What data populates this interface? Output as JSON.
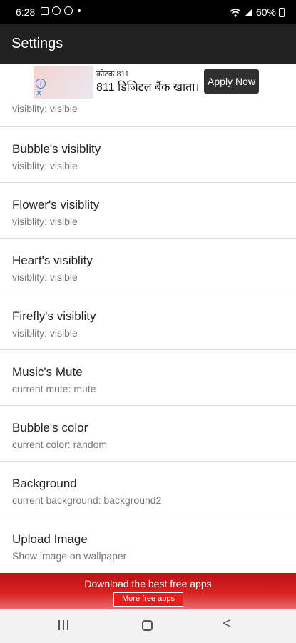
{
  "status_bar": {
    "time": "6:28",
    "battery": "60%"
  },
  "app_bar": {
    "title": "Settings"
  },
  "ad_top": {
    "line1": "कोटक 811",
    "line2": "811 डिजिटल बैंक खाता।",
    "cta": "Apply Now"
  },
  "settings": {
    "partial_summary": "visiblity: visible",
    "items": [
      {
        "title": "Bubble's visiblity",
        "summary": "visiblity: visible"
      },
      {
        "title": "Flower's visiblity",
        "summary": "visiblity: visible"
      },
      {
        "title": "Heart's visiblity",
        "summary": "visiblity: visible"
      },
      {
        "title": "Firefly's visiblity",
        "summary": "visiblity: visible"
      },
      {
        "title": "Music's Mute",
        "summary": "current mute: mute"
      },
      {
        "title": "Bubble's color",
        "summary": "current color: random"
      },
      {
        "title": "Background",
        "summary": "current background: background2"
      },
      {
        "title": "Upload Image",
        "summary": "Show image on wallpaper"
      }
    ]
  },
  "ad_bottom": {
    "text": "Download the best free apps",
    "button": "More free apps"
  },
  "icons": [
    "image-icon",
    "grid-icon",
    "wifi-icon",
    "signal-icon",
    "battery-icon",
    "adchoices-icon",
    "recents-icon",
    "home-icon",
    "back-icon"
  ]
}
